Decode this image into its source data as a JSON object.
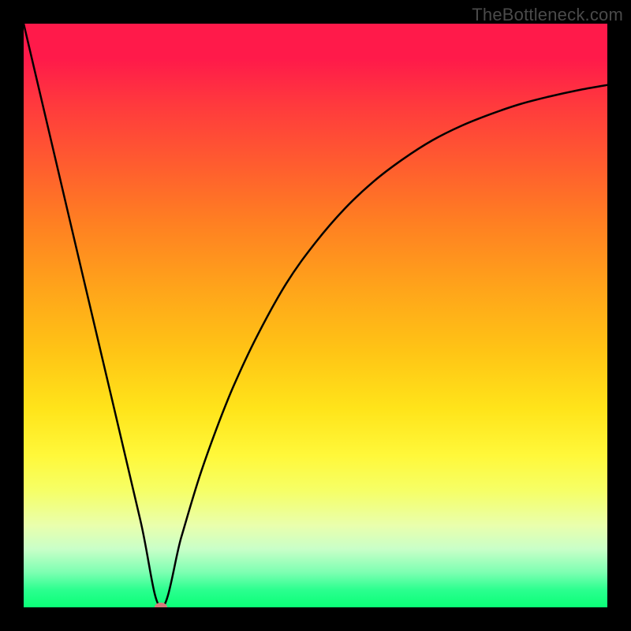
{
  "watermark": "TheBottleneck.com",
  "chart_data": {
    "type": "line",
    "title": "",
    "xlabel": "",
    "ylabel": "",
    "xlim": [
      0,
      100
    ],
    "ylim": [
      0,
      100
    ],
    "grid": false,
    "legend": false,
    "series": [
      {
        "name": "curve",
        "x": [
          0,
          5,
          10,
          15,
          20,
          23.5,
          27,
          30,
          33,
          36,
          40,
          45,
          50,
          55,
          60,
          65,
          70,
          75,
          80,
          85,
          90,
          95,
          100
        ],
        "y": [
          100,
          78.7,
          57.4,
          36.2,
          14.9,
          0,
          12,
          22,
          30.5,
          38,
          46.5,
          55.5,
          62.5,
          68.3,
          73,
          76.8,
          80,
          82.5,
          84.5,
          86.2,
          87.5,
          88.6,
          89.5
        ]
      }
    ],
    "marker": {
      "x": 23.5,
      "y": 0
    },
    "colors": {
      "curve": "#000000",
      "marker": "#d77b7b",
      "gradient_top": "#ff1a4a",
      "gradient_bottom": "#0aff77"
    }
  }
}
